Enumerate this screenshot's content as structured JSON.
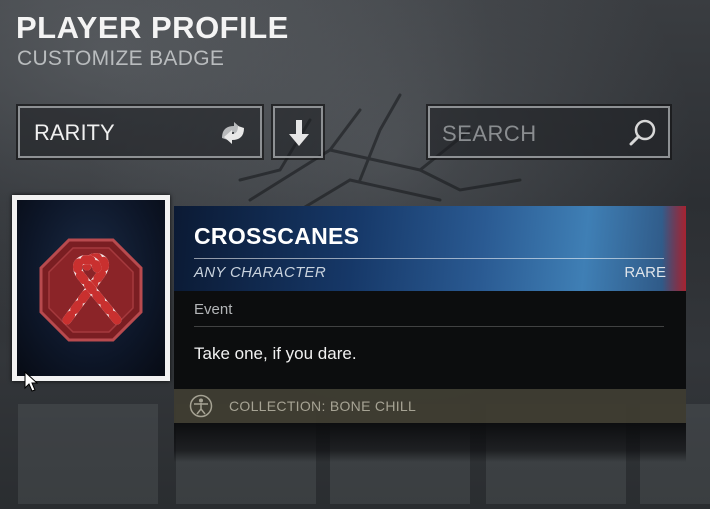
{
  "header": {
    "title": "PLAYER PROFILE",
    "subtitle": "CUSTOMIZE BADGE"
  },
  "filters": {
    "rarity_label": "RARITY",
    "sort_icon": "swap-arrows-icon",
    "order_icon": "arrow-down-icon",
    "search_placeholder": "SEARCH",
    "search_icon": "magnifier-icon"
  },
  "selected_badge": {
    "icon": "crossed-candy-canes-icon",
    "border_color": "#f2f2f2"
  },
  "tooltip": {
    "name": "CROSSCANES",
    "owner": "ANY CHARACTER",
    "rarity": "RARE",
    "category": "Event",
    "description": "Take one, if you dare.",
    "collection": "COLLECTION: BONE CHILL",
    "collection_icon": "vitruvian-man-icon",
    "header_color": "#2a5a92",
    "rarity_accent_color": "#b41e28"
  }
}
